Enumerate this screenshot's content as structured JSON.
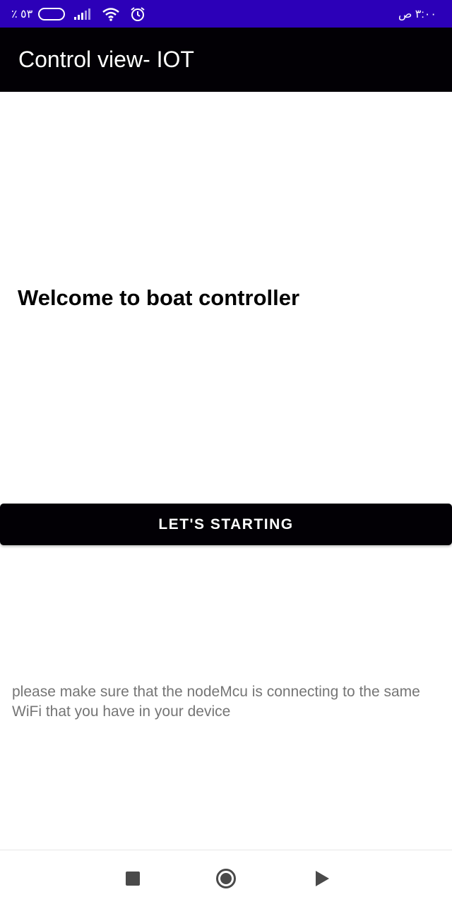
{
  "status_bar": {
    "battery_text": "٪ ٥٣",
    "battery_level": 0.53,
    "time_text": "٣:٠٠ ص",
    "background_color": "#2c00b8"
  },
  "app_bar": {
    "title": "Control view- IOT",
    "background_color": "#020005"
  },
  "main": {
    "welcome_text": "Welcome to boat controller",
    "start_button_label": "LET'S STARTING",
    "note_text": "please make sure that the nodeMcu is connecting to the same WiFi that you have in your device"
  },
  "nav_bar": {
    "icons": [
      "recents-icon",
      "home-icon",
      "back-icon"
    ]
  }
}
